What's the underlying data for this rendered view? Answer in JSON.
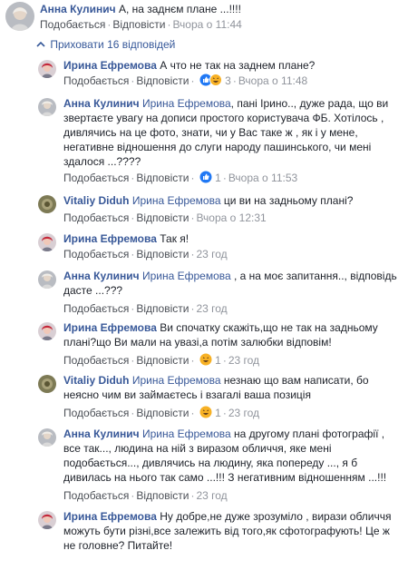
{
  "top_comment": {
    "author": "Анна Кулинич",
    "text": "А, на заднєм плане ...!!!!",
    "like": "Подобається",
    "reply": "Відповісти",
    "time": "Вчора о 11:44"
  },
  "toggle_label": "Приховати 16 відповідей",
  "replies": [
    {
      "author": "Ирина Ефремова",
      "text": "А что не так на заднем плане?",
      "like": "Подобається",
      "reply": "Відповісти",
      "reactions": "3",
      "time": "Вчора о 11:48",
      "reaction_icons": [
        "like-icon",
        "haha-icon"
      ]
    },
    {
      "author": "Анна Кулинич",
      "mention": "Ирина Ефремова",
      "text": ", пані Ірино.., дуже рада, що ви звертаєте увагу на дописи простого користувача ФБ. Хотілось , дивлячись на це фото, знати, чи у Вас таке ж , як і у мене, негативне відношення до слуги народу пашинського, чи мені здалося ...????",
      "like": "Подобається",
      "reply": "Відповісти",
      "reactions": "1",
      "time": "Вчора о 11:53",
      "reaction_icons": [
        "like-icon"
      ]
    },
    {
      "author": "Vitaliy Diduh",
      "mention": "Ирина Ефремова",
      "text": "ци ви на задньому плані?",
      "like": "Подобається",
      "reply": "Відповісти",
      "time": "Вчора о 12:31"
    },
    {
      "author": "Ирина Ефремова",
      "text": "Так я!",
      "like": "Подобається",
      "reply": "Відповісти",
      "time": "23 год"
    },
    {
      "author": "Анна Кулинич",
      "mention": "Ирина Ефремова",
      "text": ", а на моє запитання.., відповідь дасте ...???",
      "like": "Подобається",
      "reply": "Відповісти",
      "time": "23 год"
    },
    {
      "author": "Ирина Ефремова",
      "text": "Ви спочатку скажіть,що не так на задньому плані?що Ви мали на увазі,а потім залюбки відповім!",
      "like": "Подобається",
      "reply": "Відповісти",
      "reactions": "1",
      "time": "23 год",
      "reaction_icons": [
        "haha-icon"
      ]
    },
    {
      "author": "Vitaliy Diduh",
      "mention": "Ирина Ефремова",
      "text": "незнаю що вам написати, бо неясно чим ви займаєтесь і взагалі ваша позиція",
      "like": "Подобається",
      "reply": "Відповісти",
      "reactions": "1",
      "time": "23 год",
      "reaction_icons": [
        "haha-icon"
      ]
    },
    {
      "author": "Анна Кулинич",
      "mention": "Ирина Ефремова",
      "text": "на другому плані фотографії , все так..., людина на ній з виразом обличчя, яке мені подобається..., дивлячись на людину, яка попереду ..., я б дивилась на нього так само ...!!! З негативним відношенням ...!!!",
      "like": "Подобається",
      "reply": "Відповісти",
      "time": "23 год"
    },
    {
      "author": "Ирина Ефремова",
      "text": "Ну добре,не дуже зрозуміло , вирази обличчя можуть бути різні,все залежить від того,як сфотографують! Це ж не головне? Питайте!",
      "like": "Подобається",
      "reply": "Відповісти",
      "time": "23 год"
    }
  ],
  "colors": {
    "name": "#385898",
    "text": "#1d2129",
    "meta": "#90949c",
    "like_blue": "#2078f4",
    "haha_yellow": "#f7b125"
  }
}
